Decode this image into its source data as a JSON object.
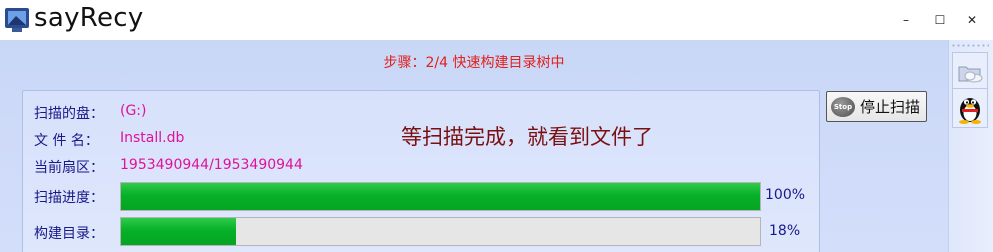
{
  "window": {
    "title": "sayRecy",
    "logo_icon": "app-logo-icon",
    "controls": {
      "minimize": "–",
      "maximize": "☐",
      "close": "✕"
    }
  },
  "step": {
    "text": "步骤：2/4 快速构建目录树中"
  },
  "scan": {
    "disk_label": "扫描的盘：",
    "disk_value": "(G:)",
    "file_label": "文 件 名：",
    "file_value": "Install.db",
    "sector_label": "当前扇区：",
    "sector_value": "1953490944/1953490944",
    "message": "等扫描完成，就看到文件了",
    "progress_label": "扫描进度：",
    "progress_value": 100,
    "progress_text": "100%",
    "build_label": "构建目录：",
    "build_value": 18,
    "build_text": "18%"
  },
  "stop_button": {
    "label": "停止扫描",
    "icon": "stop-icon",
    "icon_text": "Stop"
  },
  "sidebar": {
    "items": [
      "folder-cloud-icon",
      "qq-penguin-icon"
    ]
  },
  "colors": {
    "accent_red": "#e2201c",
    "value_magenta": "#e0129a",
    "label_blue": "#1a1a8a",
    "progress_green": "#06b028",
    "panel_bg": "#d7e1fb"
  }
}
